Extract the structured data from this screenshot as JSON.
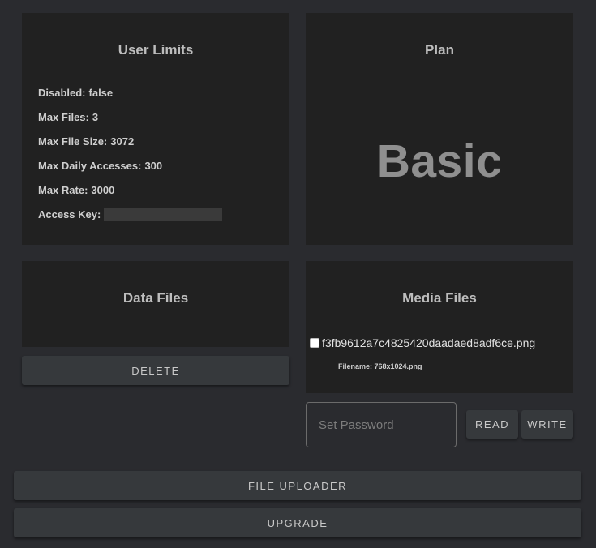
{
  "user_limits": {
    "title": "User Limits",
    "rows": [
      {
        "label": "Disabled:",
        "value": "false"
      },
      {
        "label": "Max Files:",
        "value": "3"
      },
      {
        "label": "Max File Size:",
        "value": "3072"
      },
      {
        "label": "Max Daily Accesses:",
        "value": "300"
      },
      {
        "label": "Max Rate:",
        "value": "3000"
      }
    ],
    "access_key_label": "Access Key:"
  },
  "plan": {
    "title": "Plan",
    "value": "Basic"
  },
  "data_files": {
    "title": "Data Files",
    "delete_label": "DELETE"
  },
  "media_files": {
    "title": "Media Files",
    "items": [
      {
        "name": "f3fb9612a7c4825420daadaed8adf6ce.png",
        "meta": "Filename: 768x1024.png",
        "checked": false
      }
    ]
  },
  "password": {
    "placeholder": "Set Password",
    "read_label": "READ",
    "write_label": "WRITE"
  },
  "actions": {
    "file_uploader_label": "FILE UPLOADER",
    "upgrade_label": "UPGRADE"
  },
  "colors": {
    "background": "#2a2b2f",
    "card": "#212121",
    "button": "#36393c"
  }
}
